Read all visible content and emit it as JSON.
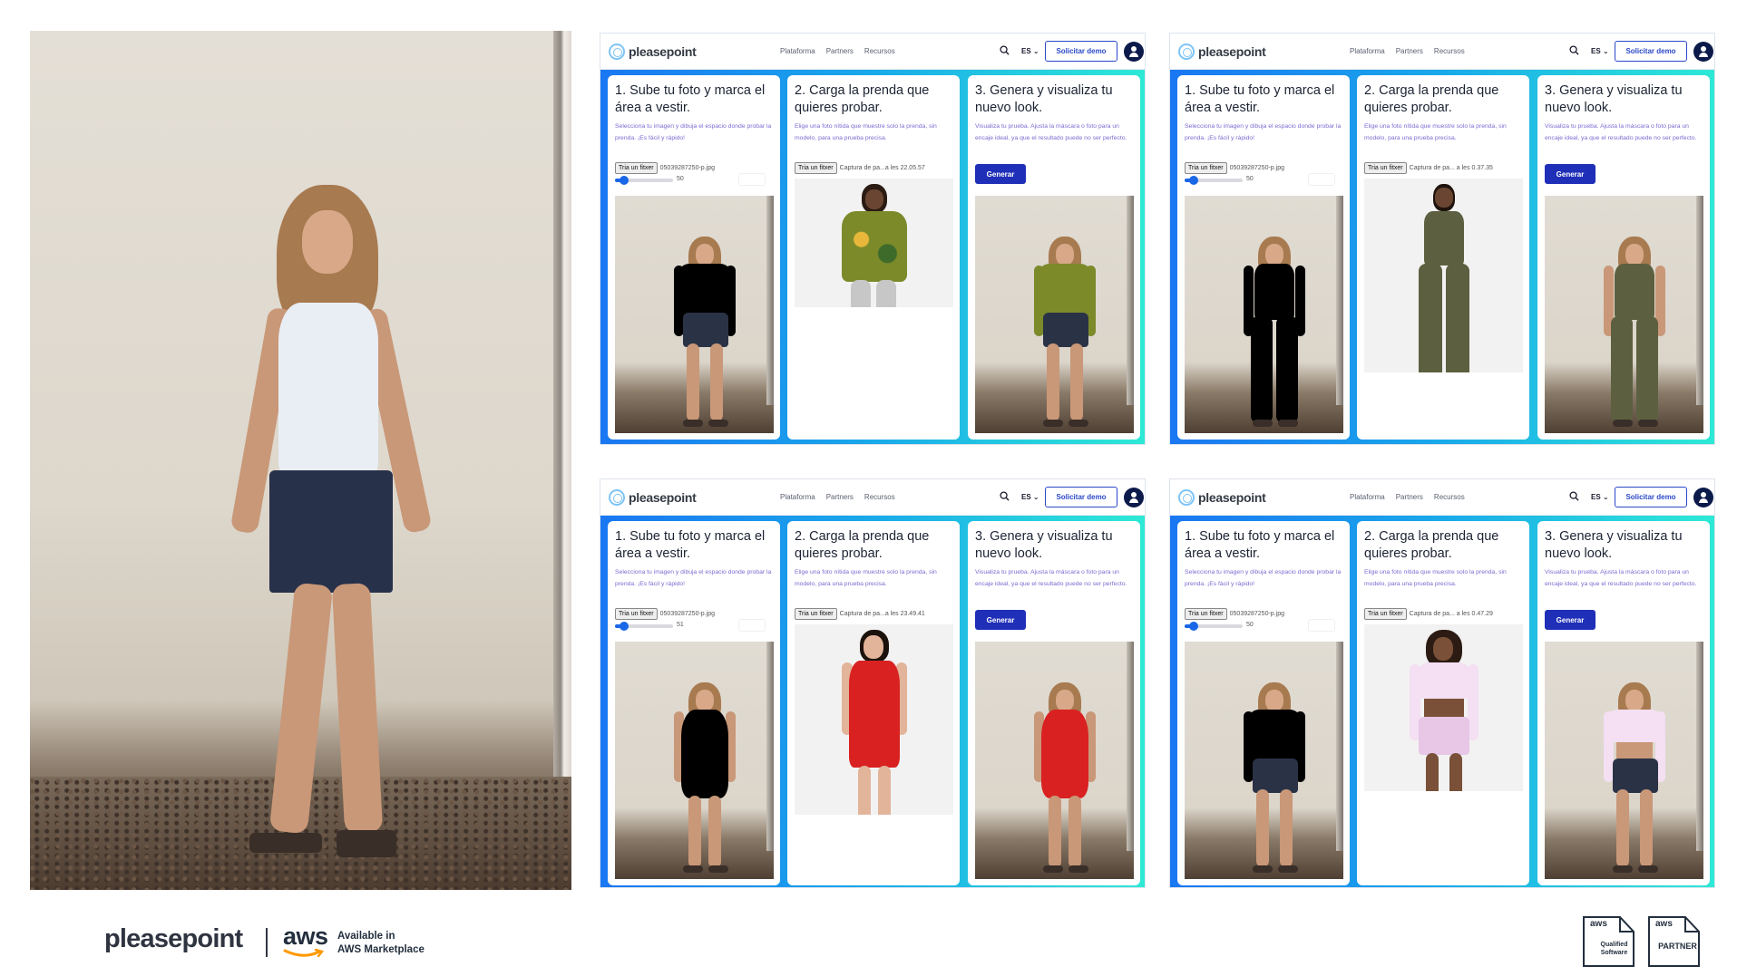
{
  "brand": {
    "name": "pleasepoint"
  },
  "nav": {
    "links": [
      "Plataforma",
      "Partners",
      "Recursos"
    ],
    "lang": "ES",
    "demo": "Solicitar demo"
  },
  "steps": {
    "step1_title": "1. Sube tu foto y marca el área a vestir.",
    "step1_desc": "Selecciona tu imagen y dibuja el espacio donde probar la prenda. ¡Es fácil y rápido!",
    "step2_title": "2. Carga la prenda que quieres probar.",
    "step2_desc": "Elige una foto nítida que muestre solo la prenda, sin modelo, para una prueba precisa.",
    "step3_title": "3. Genera y visualiza tu nuevo look.",
    "step3_desc": "Visualiza tu prueba. Ajusta la máscara o foto para un encaje ideal, ya que el resultado puede no ser perfecto.",
    "file_button": "Tria un fitxer",
    "generate": "Generar"
  },
  "panels": [
    {
      "person_file": "05039287250-p.jpg",
      "slider": "50",
      "slider_pct": 12,
      "garment_file": "Captura de pa...a les 22.05.57",
      "garment": "floral-sweatshirt",
      "garment_color": "#7c8a2a",
      "accent": "#e9b83a"
    },
    {
      "person_file": "05039287250-p.jpg",
      "slider": "50",
      "slider_pct": 12,
      "garment_file": "Captura de pa... a les 0.37.35",
      "garment": "olive-jumpsuit",
      "garment_color": "#5d6040",
      "accent": "#5d6040"
    },
    {
      "person_file": "05039287250-p.jpg",
      "slider": "51",
      "slider_pct": 13,
      "garment_file": "Captura de pa...a les 23.49.41",
      "garment": "red-dress",
      "garment_color": "#d92121",
      "accent": "#d92121"
    },
    {
      "person_file": "05039287250-p.jpg",
      "slider": "50",
      "slider_pct": 12,
      "garment_file": "Captura de pa... a les 0.47.29",
      "garment": "lilac-set",
      "garment_color": "#e7c6e6",
      "accent": "#f4dff3"
    }
  ],
  "footer": {
    "logo": "pleasepoint",
    "aws": "aws",
    "available_line1": "Available in",
    "available_line2": "AWS Marketplace",
    "badge1_aws": "aws",
    "badge1_line1": "Qualified",
    "badge1_line2": "Software",
    "badge2_aws": "aws",
    "badge2_text": "PARTNER"
  },
  "colors": {
    "accent_blue": "#1a77f2",
    "accent_teal": "#2ee9d6",
    "button_navy": "#1f2fb8"
  }
}
